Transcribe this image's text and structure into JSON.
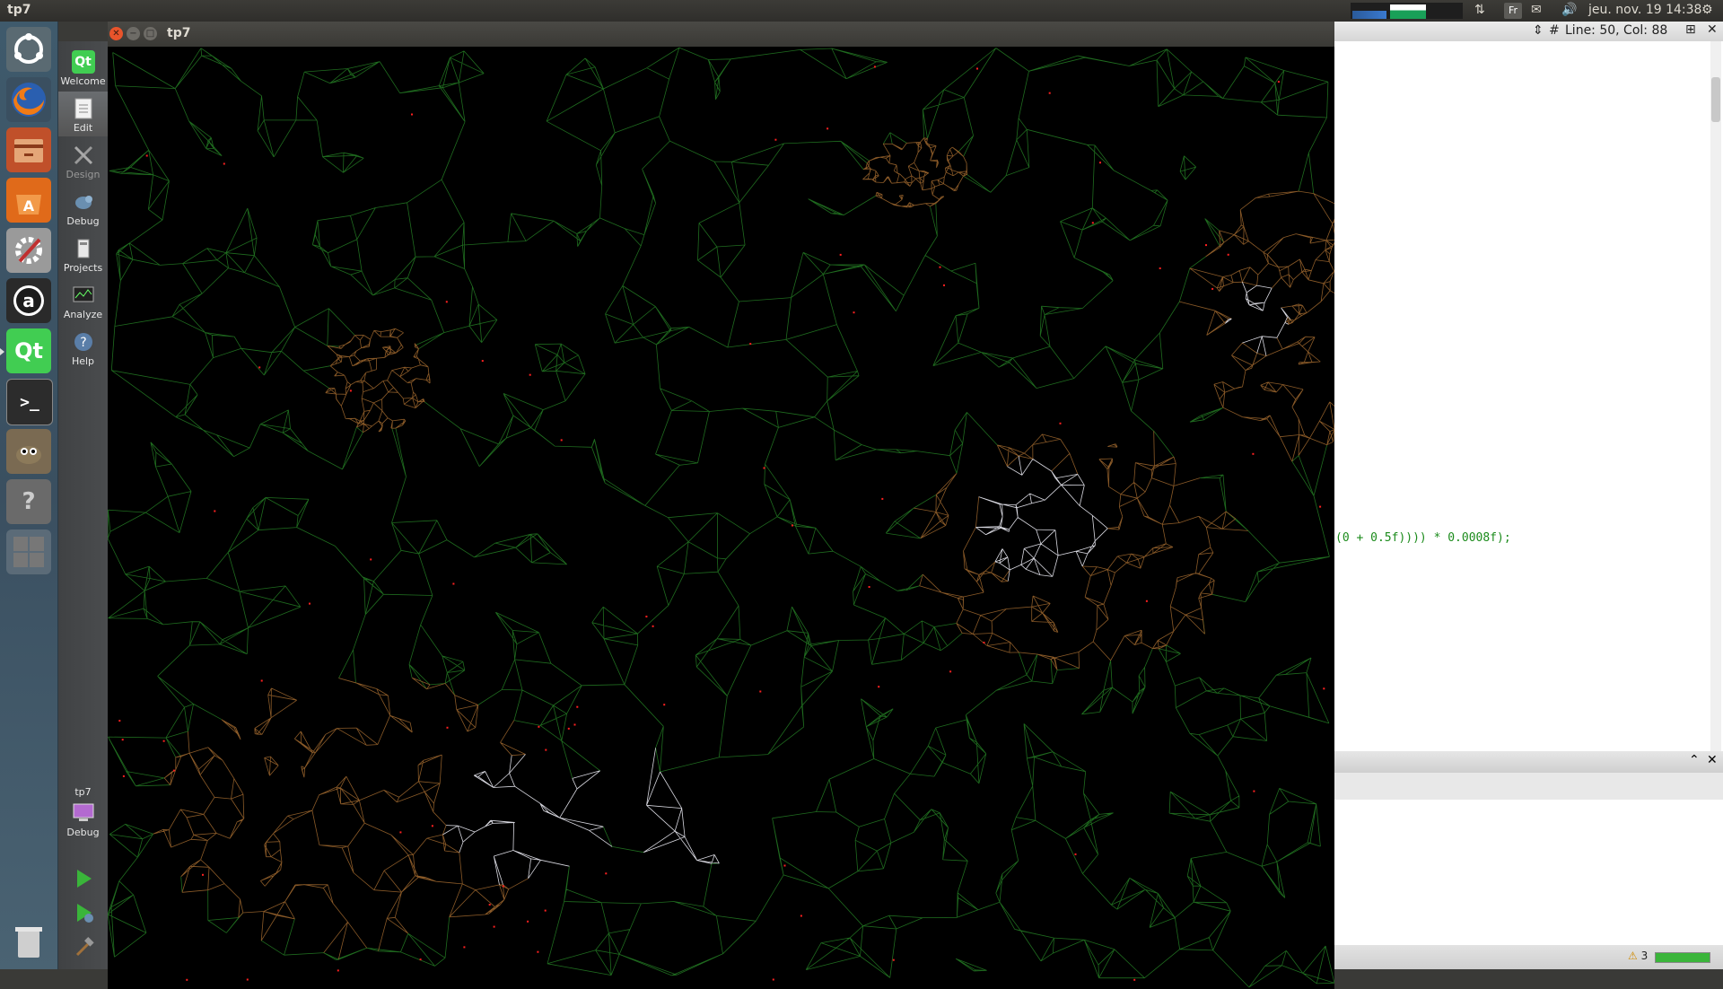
{
  "top_panel": {
    "app_title": "tp7",
    "keyboard_layout": "Fr",
    "clock": "jeu. nov. 19 14:38"
  },
  "app_window": {
    "title": "tp7"
  },
  "modes": {
    "welcome": "Welcome",
    "edit": "Edit",
    "design": "Design",
    "debug": "Debug",
    "projects": "Projects",
    "analyze": "Analyze",
    "help": "Help",
    "project_name": "tp7",
    "kit_debug": "Debug"
  },
  "editor": {
    "line_col": "Line: 50, Col: 88",
    "hash": "#",
    "code_line": "(0 + 0.5f)))) * 0.0008f);"
  },
  "status": {
    "warnings_count": "3"
  },
  "colors": {
    "grid_green": "#1f6b1f",
    "terrain_brown": "#8a5a28",
    "snow_white": "#d8d8e0",
    "marker_red": "#ff2020"
  },
  "icons": [
    "ubuntu-dash-icon",
    "firefox-icon",
    "files-icon",
    "software-center-icon",
    "settings-icon",
    "amazon-icon",
    "qt-creator-icon",
    "terminal-icon",
    "gimp-icon",
    "help-icon",
    "workspace-icon",
    "trash-icon"
  ]
}
